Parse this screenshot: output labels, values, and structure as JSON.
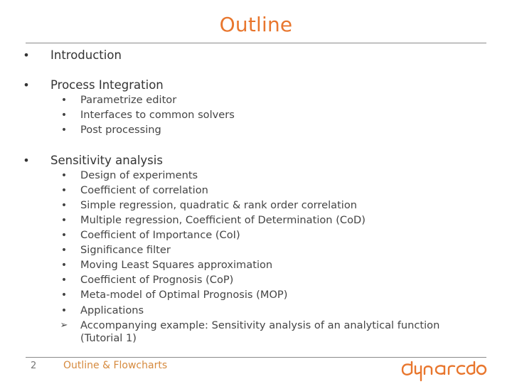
{
  "slide": {
    "title": "Outline",
    "page_number": "2",
    "footer_text": "Outline & Flowcharts",
    "brand_color": "#E8762D",
    "logo_text": "dynardo"
  },
  "outline": [
    {
      "label": "Introduction",
      "bullet": "•",
      "children": []
    },
    {
      "label": "Process Integration",
      "bullet": "•",
      "children": [
        {
          "label": "Parametrize editor",
          "bullet": "•"
        },
        {
          "label": "Interfaces to common solvers",
          "bullet": "•"
        },
        {
          "label": "Post processing",
          "bullet": "•"
        }
      ]
    },
    {
      "label": "Sensitivity analysis",
      "bullet": "•",
      "children": [
        {
          "label": "Design of experiments",
          "bullet": "•"
        },
        {
          "label": "Coefficient of correlation",
          "bullet": "•"
        },
        {
          "label": "Simple regression, quadratic & rank order correlation",
          "bullet": "•"
        },
        {
          "label": "Multiple regression, Coefficient of Determination (CoD)",
          "bullet": "•"
        },
        {
          "label": "Coefficient of Importance (CoI)",
          "bullet": "•"
        },
        {
          "label": "Significance filter",
          "bullet": "•"
        },
        {
          "label": "Moving Least Squares approximation",
          "bullet": "•"
        },
        {
          "label": "Coefficient of Prognosis (CoP)",
          "bullet": "•"
        },
        {
          "label": "Meta-model of Optimal Prognosis (MOP)",
          "bullet": "•"
        },
        {
          "label": "Applications",
          "bullet": "•"
        },
        {
          "label": "Accompanying example: Sensitivity analysis of an analytical function",
          "label_line2": "(Tutorial 1)",
          "bullet": "➢"
        }
      ]
    }
  ]
}
